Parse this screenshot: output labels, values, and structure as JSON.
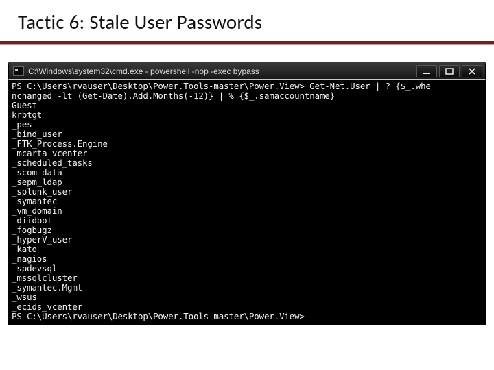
{
  "slide": {
    "title": "Tactic 6: Stale User Passwords"
  },
  "window": {
    "title": "C:\\Windows\\system32\\cmd.exe - powershell  -nop -exec bypass",
    "buttons": {
      "minimize": "minimize-icon",
      "maximize": "maximize-icon",
      "close": "close-icon"
    }
  },
  "terminal": {
    "command_line1": "PS C:\\Users\\rvauser\\Desktop\\Power.Tools-master\\Power.View> Get-Net.User | ? {$_.whe",
    "command_line2": "nchanged -lt (Get-Date).Add.Months(-12)} | % {$_.samaccountname}",
    "output": [
      "Guest",
      "krbtgt",
      "_pes",
      "_bind_user",
      "_FTK_Process.Engine",
      "_mcarta_vcenter",
      "_scheduled_tasks",
      "_scom_data",
      "_sepm_ldap",
      "_splunk_user",
      "_symantec",
      "_vm_domain",
      "_diidbot",
      "_fogbugz",
      "_hyperV_user",
      "_kato",
      "_nagios",
      "_spdevsql",
      "_mssqlcluster",
      "_symantec.Mgmt",
      "_wsus",
      "_ecids_vcenter"
    ],
    "prompt_final": "PS C:\\Users\\rvauser\\Desktop\\Power.Tools-master\\Power.View>"
  }
}
